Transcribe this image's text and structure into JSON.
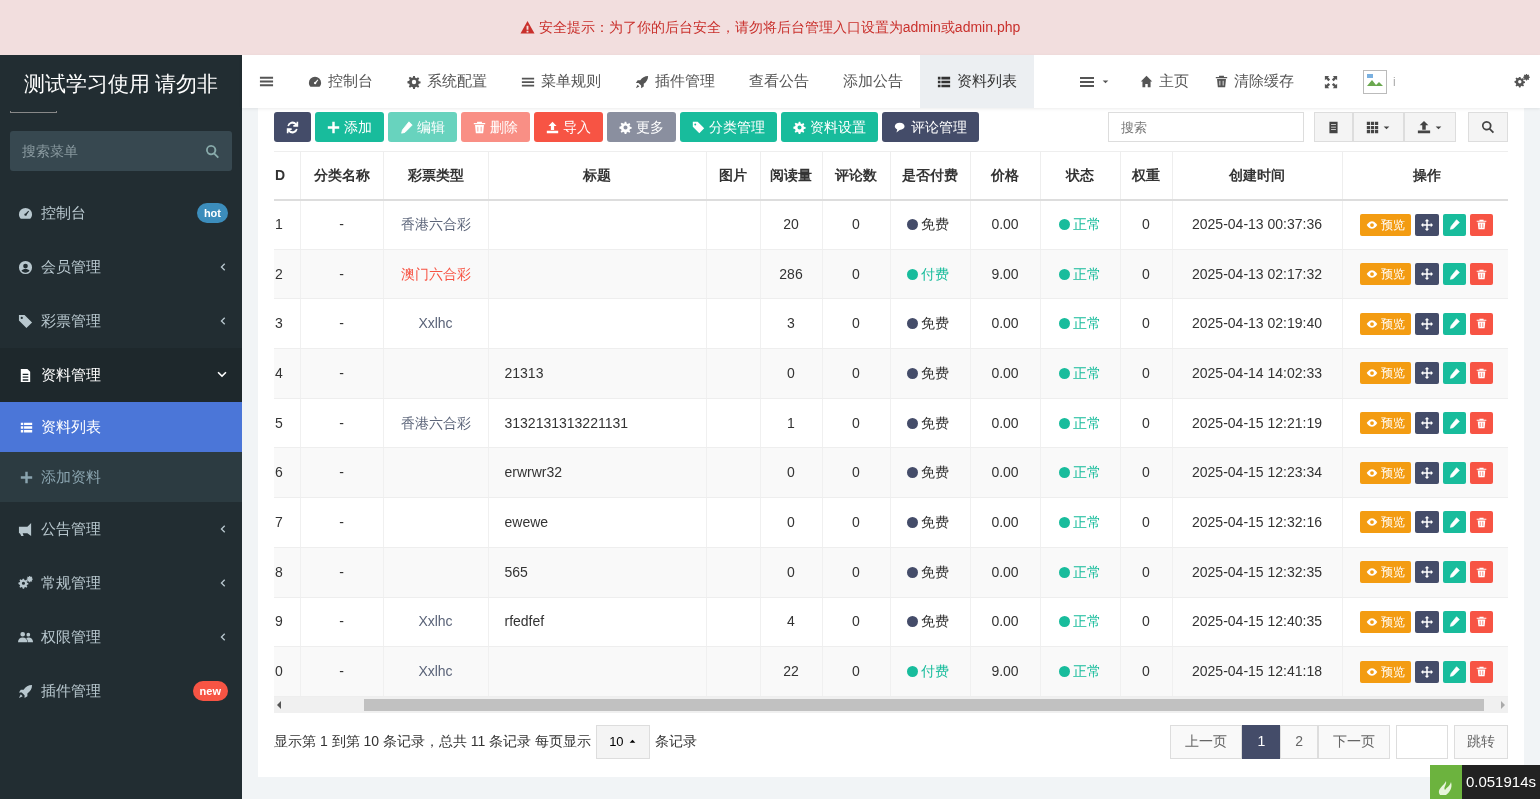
{
  "alert": {
    "text": "安全提示：为了你的后台安全，请勿将后台管理入口设置为admin或admin.php"
  },
  "brand": {
    "title": "测试学习使用 请勿非"
  },
  "sidebar": {
    "search": {
      "placeholder": "搜索菜单"
    },
    "items": [
      {
        "label": "控制台",
        "badge": "hot",
        "color": "#3c8dbc"
      },
      {
        "label": "会员管理"
      },
      {
        "label": "彩票管理"
      },
      {
        "label": "资料管理",
        "expanded": true,
        "children": [
          {
            "label": "资料列表",
            "selected": true
          },
          {
            "label": "添加资料",
            "selected": false
          }
        ]
      },
      {
        "label": "公告管理"
      },
      {
        "label": "常规管理"
      },
      {
        "label": "权限管理"
      },
      {
        "label": "插件管理",
        "badge": "new",
        "color": "#f75444"
      }
    ]
  },
  "tabs": [
    {
      "label": "控制台",
      "selected": false
    },
    {
      "label": "系统配置",
      "selected": false
    },
    {
      "label": "菜单规则",
      "selected": false
    },
    {
      "label": "插件管理",
      "selected": false
    },
    {
      "label": "查看公告",
      "selected": false
    },
    {
      "label": "添加公告",
      "selected": false
    },
    {
      "label": "资料列表",
      "selected": true
    }
  ],
  "nav_right": [
    {
      "label": "主页"
    },
    {
      "label": "清除缓存"
    }
  ],
  "nav_small_text": "i",
  "toolbar": [
    {
      "kind": "dark",
      "disabled": false
    },
    {
      "kind": "success",
      "label": "添加",
      "disabled": false
    },
    {
      "kind": "success",
      "label": "编辑",
      "disabled": true
    },
    {
      "kind": "danger",
      "label": "删除",
      "disabled": true
    },
    {
      "kind": "danger",
      "label": "导入",
      "disabled": false
    },
    {
      "kind": "gray",
      "label": "更多",
      "disabled": false
    },
    {
      "kind": "success",
      "label": "分类管理",
      "disabled": false
    },
    {
      "kind": "success",
      "label": "资料设置",
      "disabled": false
    },
    {
      "kind": "dark",
      "label": "评论管理",
      "disabled": false
    }
  ],
  "search": {
    "placeholder": "搜索"
  },
  "table": {
    "columns": [
      "D",
      "分类名称",
      "彩票类型",
      "标题",
      "图片",
      "阅读量",
      "评论数",
      "是否付费",
      "价格",
      "状态",
      "权重",
      "创建时间",
      "操作"
    ],
    "rows": [
      {
        "id": "1",
        "category": "-",
        "lottery": "香港六合彩",
        "color": "#5b6479",
        "title": "",
        "reads": "20",
        "comments": "0",
        "paid": {
          "label": "免费",
          "kind": "free"
        },
        "price": "0.00",
        "status": "正常",
        "weight": "0",
        "created": "2025-04-13 00:37:36",
        "action": "预览"
      },
      {
        "id": "2",
        "category": "-",
        "lottery": "澳门六合彩",
        "color": "#f75444",
        "title": "",
        "reads": "286",
        "comments": "0",
        "paid": {
          "label": "付费",
          "kind": "paid"
        },
        "price": "9.00",
        "status": "正常",
        "weight": "0",
        "created": "2025-04-13 02:17:32",
        "action": "预览"
      },
      {
        "id": "3",
        "category": "-",
        "lottery": "Xxlhc",
        "color": "#5b6479",
        "title": "",
        "reads": "3",
        "comments": "0",
        "paid": {
          "label": "免费",
          "kind": "free"
        },
        "price": "0.00",
        "status": "正常",
        "weight": "0",
        "created": "2025-04-13 02:19:40",
        "action": "预览"
      },
      {
        "id": "4",
        "category": "-",
        "title": "21313",
        "reads": "0",
        "comments": "0",
        "paid": {
          "label": "免费",
          "kind": "free"
        },
        "price": "0.00",
        "status": "正常",
        "weight": "0",
        "created": "2025-04-14 14:02:33",
        "action": "预览"
      },
      {
        "id": "5",
        "category": "-",
        "lottery": "香港六合彩",
        "color": "#5b6479",
        "title": "3132131313221131",
        "reads": "1",
        "comments": "0",
        "paid": {
          "label": "免费",
          "kind": "free"
        },
        "price": "0.00",
        "status": "正常",
        "weight": "0",
        "created": "2025-04-15 12:21:19",
        "action": "预览"
      },
      {
        "id": "6",
        "category": "-",
        "title": "erwrwr32",
        "reads": "0",
        "comments": "0",
        "paid": {
          "label": "免费",
          "kind": "free"
        },
        "price": "0.00",
        "status": "正常",
        "weight": "0",
        "created": "2025-04-15 12:23:34",
        "action": "预览"
      },
      {
        "id": "7",
        "category": "-",
        "title": "ewewe",
        "reads": "0",
        "comments": "0",
        "paid": {
          "label": "免费",
          "kind": "free"
        },
        "price": "0.00",
        "status": "正常",
        "weight": "0",
        "created": "2025-04-15 12:32:16",
        "action": "预览"
      },
      {
        "id": "8",
        "category": "-",
        "title": "565",
        "reads": "0",
        "comments": "0",
        "paid": {
          "label": "免费",
          "kind": "free"
        },
        "price": "0.00",
        "status": "正常",
        "weight": "0",
        "created": "2025-04-15 12:32:35",
        "action": "预览"
      },
      {
        "id": "9",
        "category": "-",
        "lottery": "Xxlhc",
        "color": "#5b6479",
        "title": "rfedfef",
        "reads": "4",
        "comments": "0",
        "paid": {
          "label": "免费",
          "kind": "free"
        },
        "price": "0.00",
        "status": "正常",
        "weight": "0",
        "created": "2025-04-15 12:40:35",
        "action": "预览"
      },
      {
        "id": "0",
        "category": "-",
        "lottery": "Xxlhc",
        "color": "#5b6479",
        "reads": "22",
        "comments": "0",
        "paid": {
          "label": "付费",
          "kind": "paid"
        },
        "price": "9.00",
        "status": "正常",
        "weight": "0",
        "created": "2025-04-15 12:41:18",
        "action": "预览"
      }
    ]
  },
  "pagination": {
    "summary": "显示第 1 到第 10 条记录，总共 11 条记录 每页显示",
    "page_size": "10",
    "suffix": "条记录",
    "prev": "上一页",
    "pages": [
      {
        "label": "1",
        "selected": true
      },
      {
        "label": "2",
        "selected": false
      }
    ],
    "next": "下一页",
    "jump": "跳转"
  },
  "timer": "0.051914s"
}
